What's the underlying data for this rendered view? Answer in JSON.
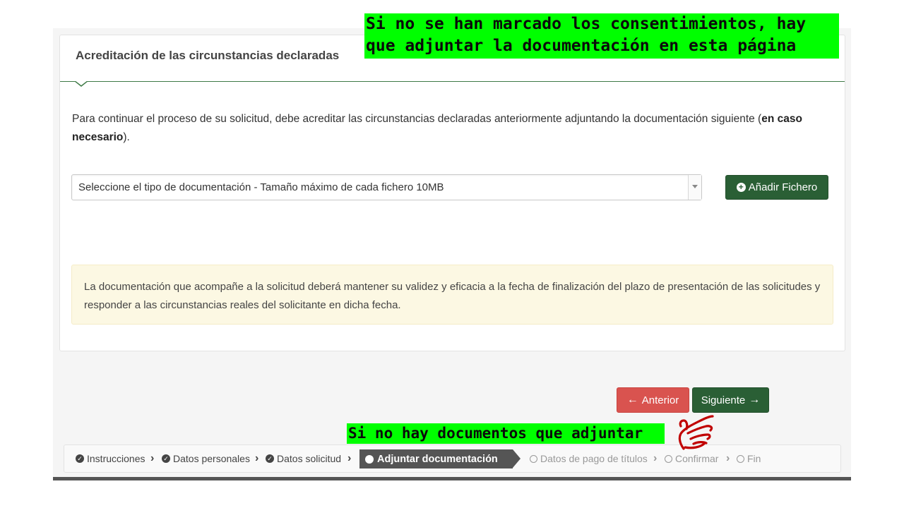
{
  "card": {
    "title": "Acreditación de las circunstancias declaradas",
    "intro_part1": "Para continuar el proceso de su solicitud, debe acreditar las circunstancias declaradas anteriormente adjuntando la documentación siguiente (",
    "intro_bold": "en caso necesario",
    "intro_part2": ")."
  },
  "doc_select": {
    "selected": "Seleccione el tipo de documentación - Tamaño máximo de cada fichero 10MB"
  },
  "add_file": {
    "label": "Añadir Fichero",
    "icon": "plus-circle-icon"
  },
  "notice": {
    "text": "La documentación que acompañe a la solicitud deberá mantener su validez y eficacia a la fecha de finalización del plazo de presentación de las solicitudes y responder a las circunstancias reales del solicitante en dicha fecha."
  },
  "nav": {
    "prev_label": "Anterior",
    "next_label": "Siguiente"
  },
  "steps": [
    {
      "label": "Instrucciones",
      "state": "done"
    },
    {
      "label": "Datos personales",
      "state": "done"
    },
    {
      "label": "Datos solicitud",
      "state": "done"
    },
    {
      "label": "Adjuntar documentación",
      "state": "active"
    },
    {
      "label": "Datos de pago de títulos",
      "state": "pending"
    },
    {
      "label": "Confirmar",
      "state": "pending"
    },
    {
      "label": "Fin",
      "state": "pending"
    }
  ],
  "annotations": {
    "top_line1": "Si no se han marcado los consentimientos, hay",
    "top_line2": "que adjuntar la documentación en  esta página",
    "bottom": "Si no hay documentos que adjuntar",
    "callout_color": "#00ff00",
    "pointer_icon": "pointing-hand-icon",
    "pointer_color": "#c00000"
  },
  "colors": {
    "primary_green": "#2a5f35",
    "danger_red": "#d9534f",
    "notice_bg": "#fcf8e3",
    "active_step_bg": "#555555"
  }
}
